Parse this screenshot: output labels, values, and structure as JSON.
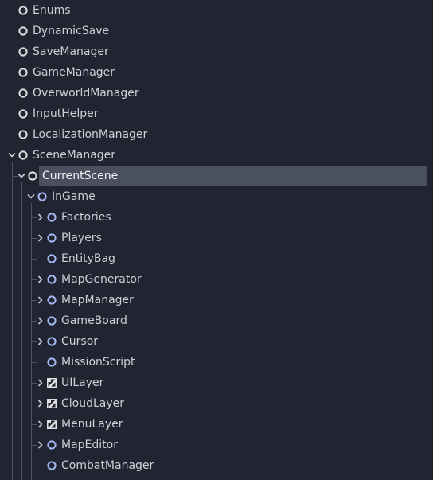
{
  "tree": {
    "nodes": [
      {
        "label": "Enums",
        "icon": "node-icon",
        "depth": 0,
        "arrow": "none"
      },
      {
        "label": "DynamicSave",
        "icon": "node-icon",
        "depth": 0,
        "arrow": "none"
      },
      {
        "label": "SaveManager",
        "icon": "node-icon",
        "depth": 0,
        "arrow": "none"
      },
      {
        "label": "GameManager",
        "icon": "node-icon",
        "depth": 0,
        "arrow": "none"
      },
      {
        "label": "OverworldManager",
        "icon": "node-icon",
        "depth": 0,
        "arrow": "none"
      },
      {
        "label": "InputHelper",
        "icon": "node-icon",
        "depth": 0,
        "arrow": "none"
      },
      {
        "label": "LocalizationManager",
        "icon": "node-icon",
        "depth": 0,
        "arrow": "none"
      },
      {
        "label": "SceneManager",
        "icon": "node-icon",
        "depth": 0,
        "arrow": "expanded"
      },
      {
        "label": "CurrentScene",
        "icon": "node-icon",
        "depth": 1,
        "arrow": "expanded",
        "selected": true
      },
      {
        "label": "InGame",
        "icon": "node2d-icon",
        "depth": 2,
        "arrow": "expanded"
      },
      {
        "label": "Factories",
        "icon": "node2d-icon",
        "depth": 3,
        "arrow": "collapsed"
      },
      {
        "label": "Players",
        "icon": "node2d-icon",
        "depth": 3,
        "arrow": "collapsed"
      },
      {
        "label": "EntityBag",
        "icon": "node2d-icon",
        "depth": 3,
        "arrow": "none"
      },
      {
        "label": "MapGenerator",
        "icon": "node2d-icon",
        "depth": 3,
        "arrow": "collapsed"
      },
      {
        "label": "MapManager",
        "icon": "node2d-icon",
        "depth": 3,
        "arrow": "collapsed"
      },
      {
        "label": "GameBoard",
        "icon": "node2d-icon",
        "depth": 3,
        "arrow": "collapsed"
      },
      {
        "label": "Cursor",
        "icon": "node2d-icon",
        "depth": 3,
        "arrow": "collapsed"
      },
      {
        "label": "MissionScript",
        "icon": "node2d-icon",
        "depth": 3,
        "arrow": "none"
      },
      {
        "label": "UILayer",
        "icon": "canvas-layer-icon",
        "depth": 3,
        "arrow": "collapsed"
      },
      {
        "label": "CloudLayer",
        "icon": "canvas-layer-icon",
        "depth": 3,
        "arrow": "collapsed"
      },
      {
        "label": "MenuLayer",
        "icon": "canvas-layer-icon",
        "depth": 3,
        "arrow": "collapsed"
      },
      {
        "label": "MapEditor",
        "icon": "node2d-icon",
        "depth": 3,
        "arrow": "collapsed"
      },
      {
        "label": "CombatManager",
        "icon": "node2d-icon",
        "depth": 3,
        "arrow": "none"
      }
    ]
  },
  "colors": {
    "background": "#202531",
    "selection": "#4a505d",
    "text": "#cdd0d6",
    "selected_text": "#f2f3f5",
    "arrow": "#c9ccd3",
    "guide_line": "#4d5361",
    "node_icon": "#e0e0e0",
    "node2d_icon": "#a5b7f3"
  }
}
